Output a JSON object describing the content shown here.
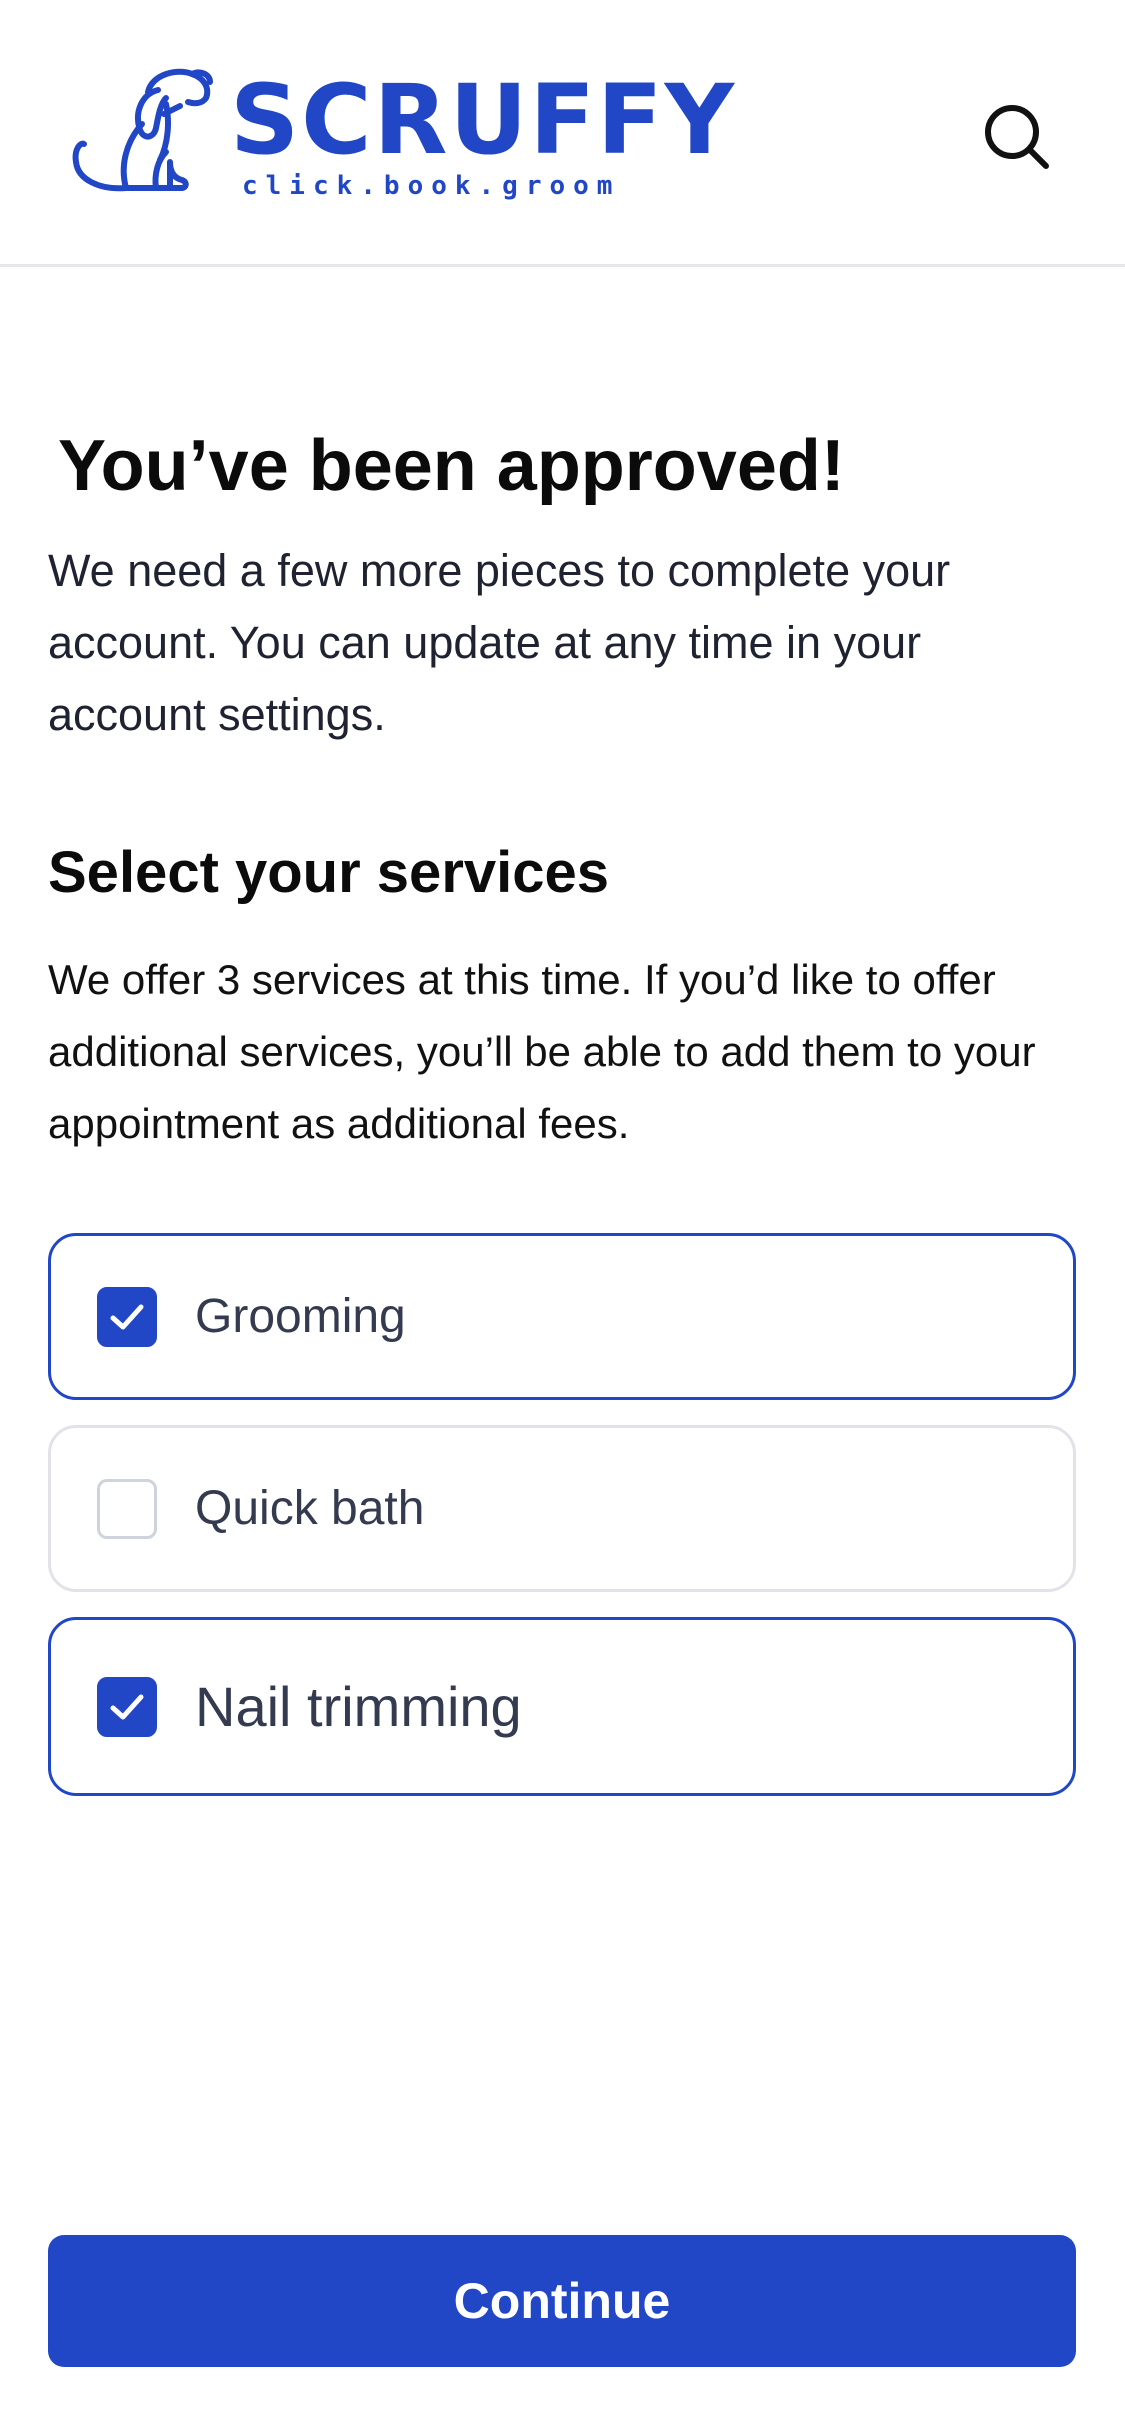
{
  "header": {
    "brand_name": "SCRUFFY",
    "tagline": "click.book.groom",
    "logo_icon": "dog-icon",
    "search_icon": "search-icon"
  },
  "main": {
    "title": "You’ve been approved!",
    "intro": "We need a few more pieces to complete your account.  You can update at any time in your account settings.",
    "section_title": "Select your services",
    "section_desc": "We offer 3 services at this time.  If you’d like to offer additional services, you’ll be able to add them to your appointment as additional fees.",
    "services": [
      {
        "label": "Grooming",
        "checked": true
      },
      {
        "label": "Quick bath",
        "checked": false
      },
      {
        "label": "Nail trimming",
        "checked": true
      }
    ],
    "continue_label": "Continue"
  },
  "colors": {
    "brand": "#2147c6",
    "option_border_checked": "#2147c6",
    "option_border_unchecked": "#e1e3e8",
    "text_dark": "#0b0b0b",
    "text_option": "#343a50"
  }
}
